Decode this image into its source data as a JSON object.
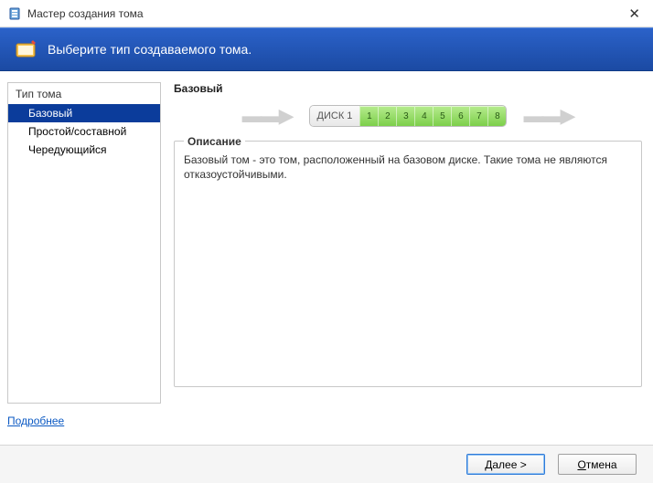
{
  "titlebar": {
    "title": "Мастер создания тома"
  },
  "header": {
    "subtitle": "Выберите тип создаваемого тома."
  },
  "sidebar": {
    "header": "Тип тома",
    "items": [
      {
        "label": "Базовый",
        "selected": true
      },
      {
        "label": "Простой/составной",
        "selected": false
      },
      {
        "label": "Чередующийся",
        "selected": false
      }
    ]
  },
  "main": {
    "type_title": "Базовый",
    "disk": {
      "label": "ДИСК 1",
      "segments": [
        "1",
        "2",
        "3",
        "4",
        "5",
        "6",
        "7",
        "8"
      ]
    },
    "description": {
      "legend": "Описание",
      "text": "Базовый том - это том, расположенный на базовом диске. Такие тома не являются отказоустойчивыми."
    }
  },
  "links": {
    "more": "Подробнее"
  },
  "footer": {
    "next_prefix": "Д",
    "next_rest": "алее >",
    "cancel_prefix": "О",
    "cancel_rest": "тмена"
  }
}
